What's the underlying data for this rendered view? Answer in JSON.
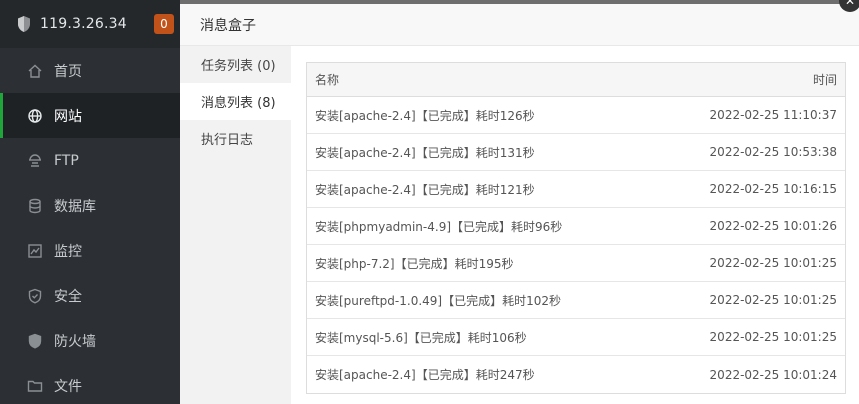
{
  "sidebar": {
    "ip": "119.3.26.34",
    "badge": "0",
    "items": [
      {
        "label": "首页",
        "icon": "home-icon"
      },
      {
        "label": "网站",
        "icon": "globe-icon",
        "active": true
      },
      {
        "label": "FTP",
        "icon": "ftp-icon"
      },
      {
        "label": "数据库",
        "icon": "database-icon"
      },
      {
        "label": "监控",
        "icon": "monitor-icon"
      },
      {
        "label": "安全",
        "icon": "shield-check-icon"
      },
      {
        "label": "防火墙",
        "icon": "firewall-icon"
      },
      {
        "label": "文件",
        "icon": "folder-icon"
      }
    ]
  },
  "dialog": {
    "title": "消息盒子",
    "close": "✕",
    "nav": [
      {
        "label": "任务列表 (0)"
      },
      {
        "label": "消息列表 (8)",
        "active": true
      },
      {
        "label": "执行日志"
      }
    ],
    "table": {
      "col_name": "名称",
      "col_time": "时间",
      "rows": [
        {
          "name": "安装[apache-2.4]【已完成】耗时126秒",
          "time": "2022-02-25 11:10:37"
        },
        {
          "name": "安装[apache-2.4]【已完成】耗时131秒",
          "time": "2022-02-25 10:53:38"
        },
        {
          "name": "安装[apache-2.4]【已完成】耗时121秒",
          "time": "2022-02-25 10:16:15"
        },
        {
          "name": "安装[phpmyadmin-4.9]【已完成】耗时96秒",
          "time": "2022-02-25 10:01:26"
        },
        {
          "name": "安装[php-7.2]【已完成】耗时195秒",
          "time": "2022-02-25 10:01:25"
        },
        {
          "name": "安装[pureftpd-1.0.49]【已完成】耗时102秒",
          "time": "2022-02-25 10:01:25"
        },
        {
          "name": "安装[mysql-5.6]【已完成】耗时106秒",
          "time": "2022-02-25 10:01:25"
        },
        {
          "name": "安装[apache-2.4]【已完成】耗时247秒",
          "time": "2022-02-25 10:01:24"
        }
      ]
    }
  },
  "colors": {
    "sidebar_bg": "#2c3034",
    "accent_green": "#20a53a",
    "badge_orange": "#c1521a"
  }
}
